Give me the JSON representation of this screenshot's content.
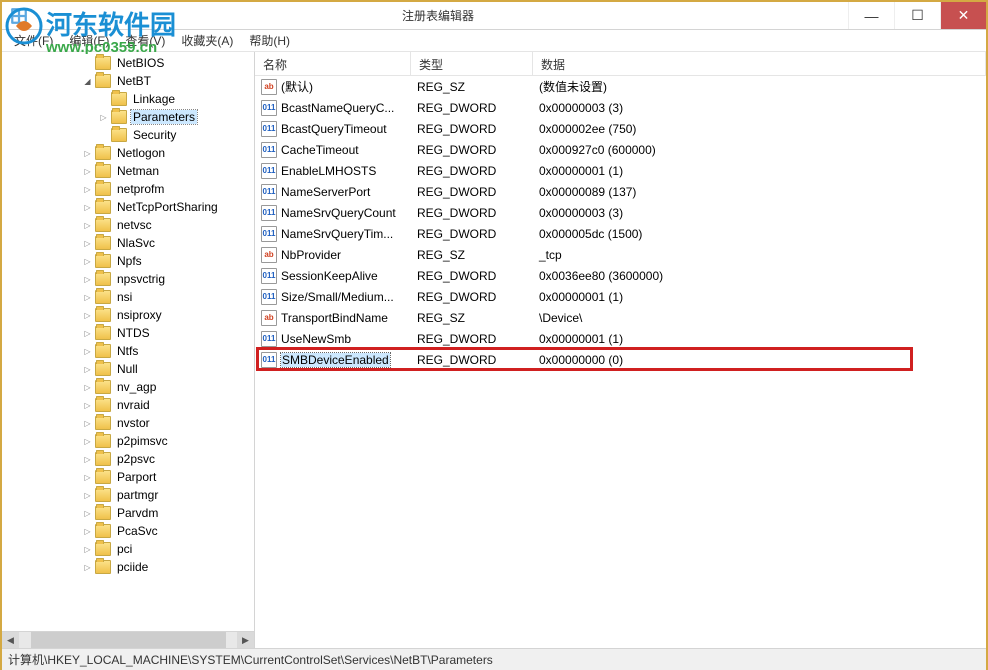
{
  "window": {
    "title": "注册表编辑器"
  },
  "menu": {
    "file": "文件(F)",
    "edit": "编辑(E)",
    "view": "查看(V)",
    "favorites": "收藏夹(A)",
    "help": "帮助(H)"
  },
  "tree": [
    {
      "indent": 5,
      "expand": "none",
      "label": "NetBIOS"
    },
    {
      "indent": 5,
      "expand": "open",
      "label": "NetBT"
    },
    {
      "indent": 6,
      "expand": "none",
      "label": "Linkage"
    },
    {
      "indent": 6,
      "expand": "closed",
      "label": "Parameters",
      "selected": true
    },
    {
      "indent": 6,
      "expand": "none",
      "label": "Security"
    },
    {
      "indent": 5,
      "expand": "closed",
      "label": "Netlogon"
    },
    {
      "indent": 5,
      "expand": "closed",
      "label": "Netman"
    },
    {
      "indent": 5,
      "expand": "closed",
      "label": "netprofm"
    },
    {
      "indent": 5,
      "expand": "closed",
      "label": "NetTcpPortSharing"
    },
    {
      "indent": 5,
      "expand": "closed",
      "label": "netvsc"
    },
    {
      "indent": 5,
      "expand": "closed",
      "label": "NlaSvc"
    },
    {
      "indent": 5,
      "expand": "closed",
      "label": "Npfs"
    },
    {
      "indent": 5,
      "expand": "closed",
      "label": "npsvctrig"
    },
    {
      "indent": 5,
      "expand": "closed",
      "label": "nsi"
    },
    {
      "indent": 5,
      "expand": "closed",
      "label": "nsiproxy"
    },
    {
      "indent": 5,
      "expand": "closed",
      "label": "NTDS"
    },
    {
      "indent": 5,
      "expand": "closed",
      "label": "Ntfs"
    },
    {
      "indent": 5,
      "expand": "closed",
      "label": "Null"
    },
    {
      "indent": 5,
      "expand": "closed",
      "label": "nv_agp"
    },
    {
      "indent": 5,
      "expand": "closed",
      "label": "nvraid"
    },
    {
      "indent": 5,
      "expand": "closed",
      "label": "nvstor"
    },
    {
      "indent": 5,
      "expand": "closed",
      "label": "p2pimsvc"
    },
    {
      "indent": 5,
      "expand": "closed",
      "label": "p2psvc"
    },
    {
      "indent": 5,
      "expand": "closed",
      "label": "Parport"
    },
    {
      "indent": 5,
      "expand": "closed",
      "label": "partmgr"
    },
    {
      "indent": 5,
      "expand": "closed",
      "label": "Parvdm"
    },
    {
      "indent": 5,
      "expand": "closed",
      "label": "PcaSvc"
    },
    {
      "indent": 5,
      "expand": "closed",
      "label": "pci"
    },
    {
      "indent": 5,
      "expand": "closed",
      "label": "pciide"
    }
  ],
  "columns": {
    "name": "名称",
    "type": "类型",
    "data": "数据"
  },
  "values": [
    {
      "icon": "sz",
      "iconText": "ab",
      "name": "(默认)",
      "type": "REG_SZ",
      "data": "(数值未设置)"
    },
    {
      "icon": "dw",
      "iconText": "011",
      "name": "BcastNameQueryC...",
      "type": "REG_DWORD",
      "data": "0x00000003 (3)"
    },
    {
      "icon": "dw",
      "iconText": "011",
      "name": "BcastQueryTimeout",
      "type": "REG_DWORD",
      "data": "0x000002ee (750)"
    },
    {
      "icon": "dw",
      "iconText": "011",
      "name": "CacheTimeout",
      "type": "REG_DWORD",
      "data": "0x000927c0 (600000)"
    },
    {
      "icon": "dw",
      "iconText": "011",
      "name": "EnableLMHOSTS",
      "type": "REG_DWORD",
      "data": "0x00000001 (1)"
    },
    {
      "icon": "dw",
      "iconText": "011",
      "name": "NameServerPort",
      "type": "REG_DWORD",
      "data": "0x00000089 (137)"
    },
    {
      "icon": "dw",
      "iconText": "011",
      "name": "NameSrvQueryCount",
      "type": "REG_DWORD",
      "data": "0x00000003 (3)"
    },
    {
      "icon": "dw",
      "iconText": "011",
      "name": "NameSrvQueryTim...",
      "type": "REG_DWORD",
      "data": "0x000005dc (1500)"
    },
    {
      "icon": "sz",
      "iconText": "ab",
      "name": "NbProvider",
      "type": "REG_SZ",
      "data": "_tcp"
    },
    {
      "icon": "dw",
      "iconText": "011",
      "name": "SessionKeepAlive",
      "type": "REG_DWORD",
      "data": "0x0036ee80 (3600000)"
    },
    {
      "icon": "dw",
      "iconText": "011",
      "name": "Size/Small/Medium...",
      "type": "REG_DWORD",
      "data": "0x00000001 (1)"
    },
    {
      "icon": "sz",
      "iconText": "ab",
      "name": "TransportBindName",
      "type": "REG_SZ",
      "data": "\\Device\\"
    },
    {
      "icon": "dw",
      "iconText": "011",
      "name": "UseNewSmb",
      "type": "REG_DWORD",
      "data": "0x00000001 (1)"
    },
    {
      "icon": "dw",
      "iconText": "011",
      "name": "SMBDeviceEnabled",
      "type": "REG_DWORD",
      "data": "0x00000000 (0)",
      "selected": true
    }
  ],
  "statusbar": "计算机\\HKEY_LOCAL_MACHINE\\SYSTEM\\CurrentControlSet\\Services\\NetBT\\Parameters",
  "watermark": {
    "line1": "河东软件园",
    "line2": "www.pc0359.cn"
  }
}
